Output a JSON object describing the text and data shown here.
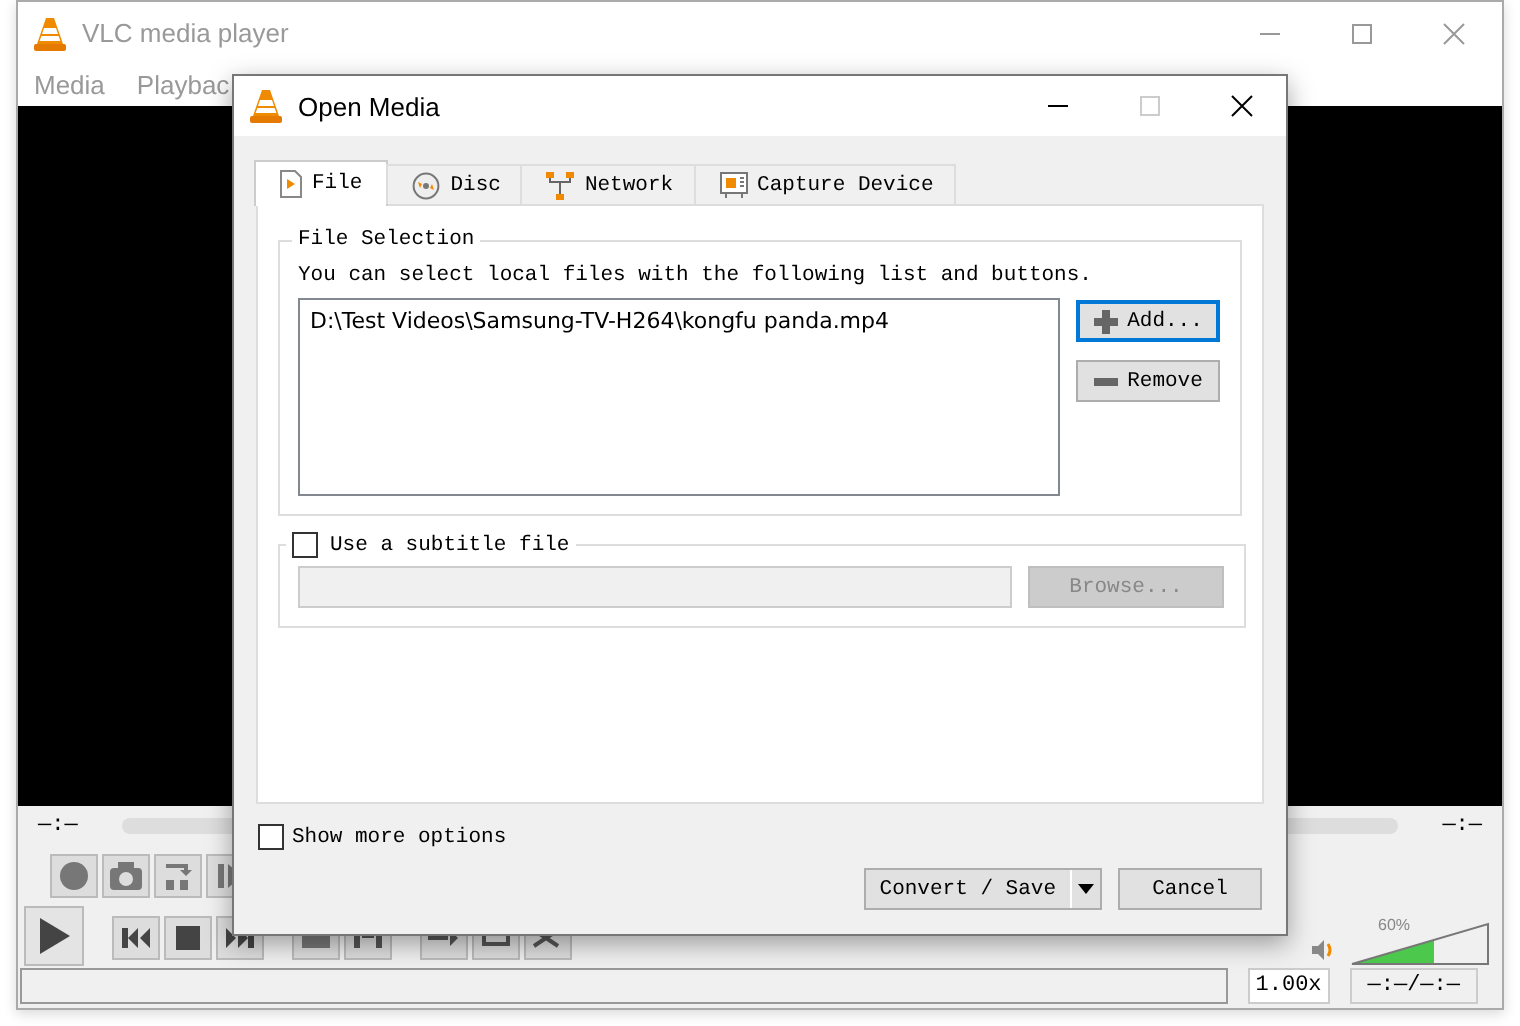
{
  "main_window": {
    "title": "VLC media player",
    "menu": [
      "Media",
      "Playbac"
    ],
    "elapsed": "—:—",
    "remaining": "—:—",
    "speed": "1.00x",
    "time_display": "—:—/—:—",
    "volume": {
      "reading": "60%",
      "level": 0.6
    }
  },
  "dialog": {
    "title": "Open Media",
    "tabs": [
      {
        "label": "File",
        "kind": "file",
        "selected": true
      },
      {
        "label": "Disc",
        "kind": "disc",
        "selected": false
      },
      {
        "label": "Network",
        "kind": "network",
        "selected": false
      },
      {
        "label": "Capture Device",
        "kind": "capture",
        "selected": false
      }
    ],
    "file_selection": {
      "legend": "File Selection",
      "hint": "You can select local files with the following list and buttons.",
      "files": [
        "D:\\Test Videos\\Samsung-TV-H264\\kongfu panda.mp4"
      ],
      "add_button": "Add...",
      "remove_button": "Remove"
    },
    "subtitle": {
      "label": "Use a subtitle file",
      "checked": false,
      "browse_button": "Browse...",
      "disabled": true
    },
    "show_more_options": {
      "label": "Show more options",
      "checked": false
    },
    "convert_button": "Convert / Save",
    "cancel_button": "Cancel"
  }
}
